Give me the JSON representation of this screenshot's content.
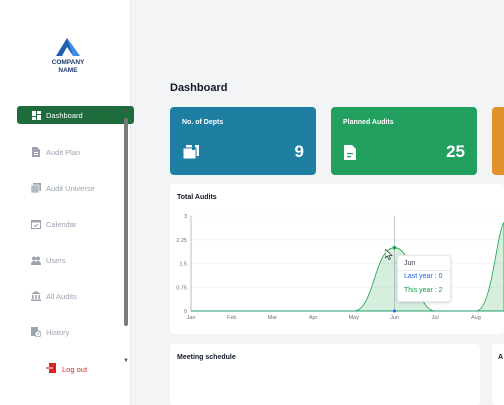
{
  "sidebar": {
    "logo": {
      "line1": "COMPANY",
      "line2": "NAME"
    },
    "items": [
      {
        "label": "Dashboard",
        "icon": "dashboard-icon"
      },
      {
        "label": "Audit Plan",
        "icon": "document-icon"
      },
      {
        "label": "Audit Universe",
        "icon": "stack-icon"
      },
      {
        "label": "Calendar",
        "icon": "calendar-icon"
      },
      {
        "label": "Users",
        "icon": "users-icon"
      },
      {
        "label": "All Audits",
        "icon": "bank-icon"
      },
      {
        "label": "History",
        "icon": "history-icon"
      }
    ],
    "logout_label": "Log out"
  },
  "header": {
    "title": "Dashboard"
  },
  "stats": [
    {
      "label": "No. of Depts",
      "value": "9",
      "color": "#1e7fa3",
      "icon": "book-icon"
    },
    {
      "label": "Planned Audits",
      "value": "25",
      "color": "#21a060",
      "icon": "file-icon"
    },
    {
      "label": "",
      "value": "",
      "color": "#e0912a",
      "icon": ""
    }
  ],
  "panels": {
    "total_audits_title": "Total Audits",
    "meeting_title": "Meeting schedule",
    "right_panel_title": "A"
  },
  "tooltip": {
    "month": "Jun",
    "last_year": "Last year : 0",
    "this_year": "This year : 2"
  },
  "chart_data": {
    "type": "area",
    "categories": [
      "Jan",
      "Feb",
      "Mar",
      "Apr",
      "May",
      "Jun",
      "Jul",
      "Aug"
    ],
    "series": [
      {
        "name": "Last year",
        "values": [
          0,
          0,
          0,
          0,
          0,
          0,
          0,
          0
        ],
        "color": "#2563eb"
      },
      {
        "name": "This year",
        "values": [
          0,
          0,
          0,
          0,
          0,
          2,
          0,
          0
        ],
        "color": "#16a34a"
      }
    ],
    "yticks": [
      0,
      0.75,
      1.5,
      2.25,
      3
    ],
    "ylim": [
      0,
      3
    ],
    "grid": true
  }
}
